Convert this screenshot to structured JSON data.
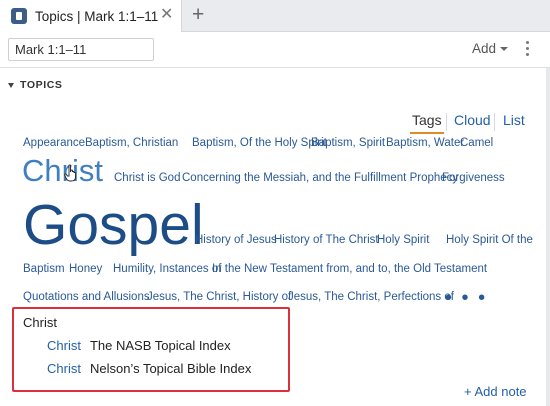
{
  "tab": {
    "title": "Topics | Mark 1:1–11",
    "close_glyph": "✕",
    "new_tab_glyph": "+"
  },
  "toolbar": {
    "reference": "Mark 1:1–11",
    "add_label": "Add"
  },
  "section": {
    "title": "TOPICS"
  },
  "view_tabs": [
    {
      "label": "Tags",
      "active": true
    },
    {
      "label": "Cloud",
      "active": false
    },
    {
      "label": "List",
      "active": false
    }
  ],
  "tags": [
    "Appearance",
    "Baptism, Christian",
    "Baptism, Of the Holy Spirit",
    "Baptism, Spirit",
    "Baptism, Water",
    "Camel",
    "Christ",
    "Christ is God",
    "Concerning the Messiah, and the Fulfillment Prophecy",
    "Forgiveness",
    "Gospel",
    "History of Jesus",
    "History of The Christ",
    "Holy Spirit",
    "Holy Spirit Of the",
    "Baptism",
    "Honey",
    "Humility, Instances of",
    "In the New Testament from, and to, the Old Testament",
    "Quotations and Allusions",
    "Jesus, The Christ, History of",
    "Jesus, The Christ, Perfections of"
  ],
  "more_glyph": "• • •",
  "results": {
    "heading": "Christ",
    "rows": [
      {
        "link": "Christ",
        "title": "The NASB Topical Index"
      },
      {
        "link": "Christ",
        "title": "Nelson’s Topical Bible Index"
      }
    ]
  },
  "add_note": "+ Add note",
  "colors": {
    "accent_underline": "#e08b2a",
    "link": "#2460a7",
    "highlight_box": "#d9323d",
    "brand_icon": "#3b5d86"
  }
}
